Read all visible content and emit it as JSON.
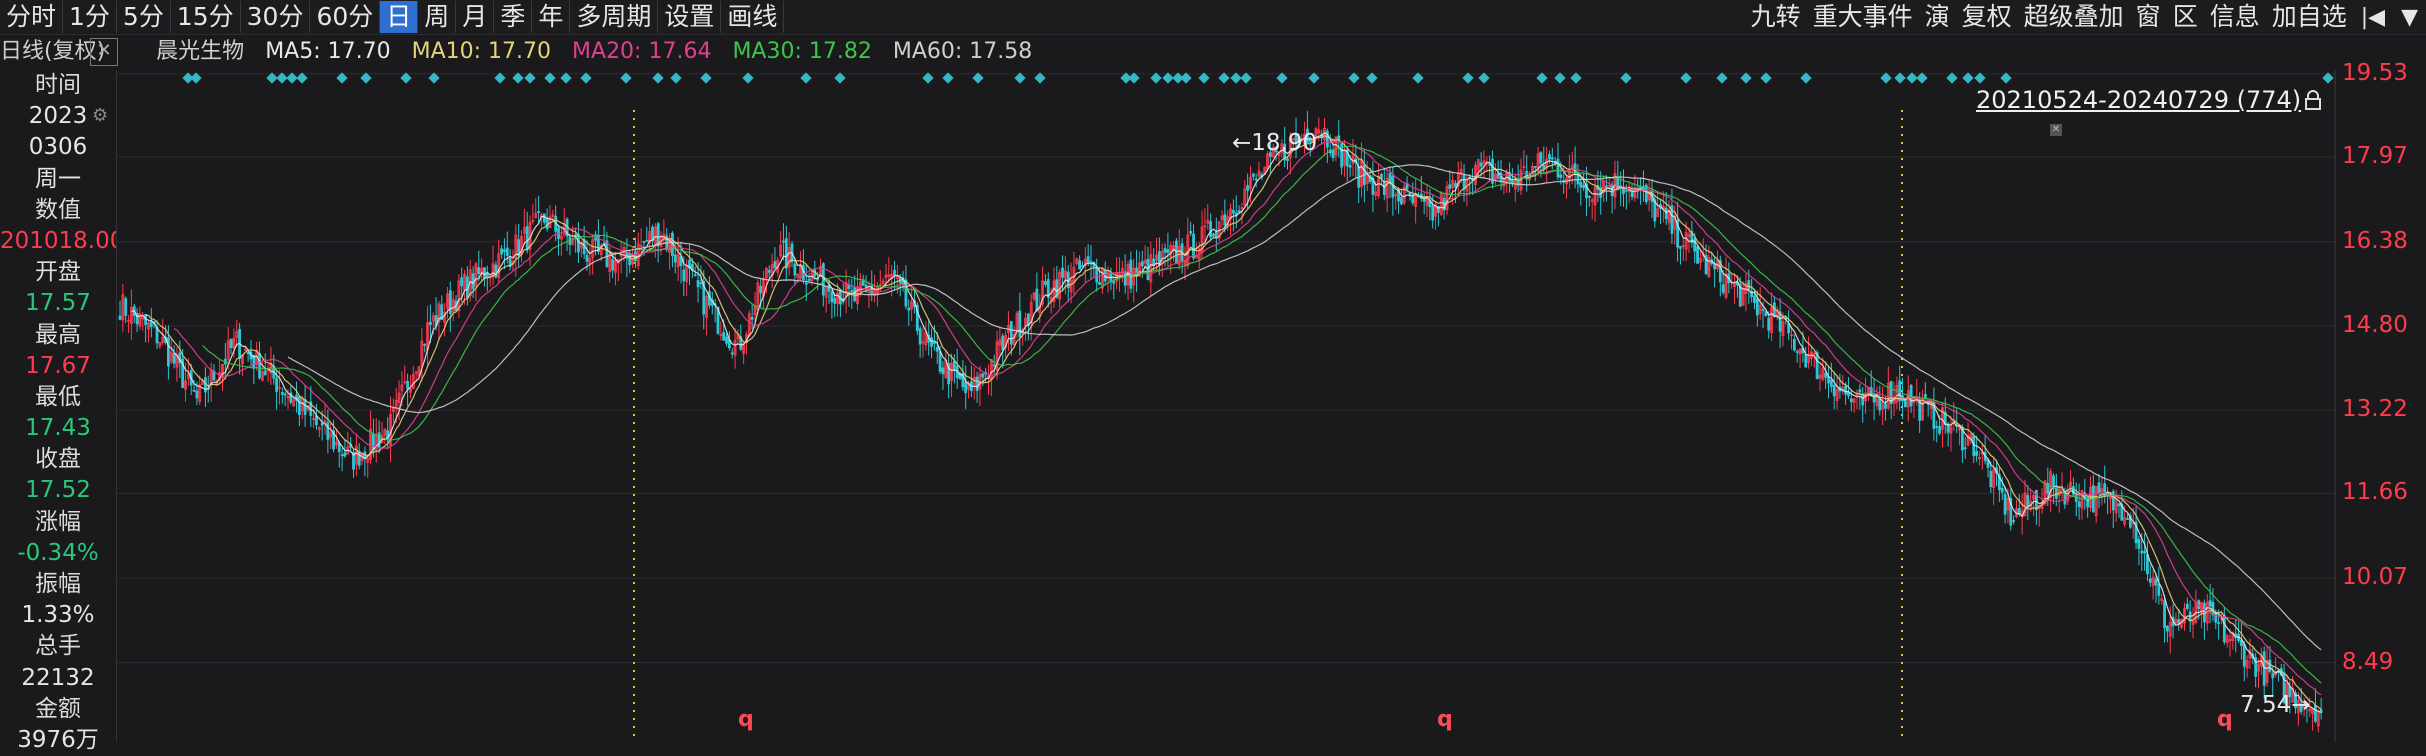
{
  "toolbar": {
    "periods": [
      "分时",
      "1分",
      "5分",
      "15分",
      "30分",
      "60分",
      "日",
      "周",
      "月",
      "季",
      "年",
      "多周期",
      "设置",
      "画线"
    ],
    "active_period": "日",
    "right_items": [
      "九转",
      "重大事件",
      "演",
      "复权",
      "超级叠加",
      "窗",
      "区",
      "信息",
      "加自选"
    ],
    "icons": [
      "prev-chart-icon",
      "dropdown-icon"
    ]
  },
  "ma_bar": {
    "period": "日线(复权)",
    "stock_name": "晨光生物",
    "ma5": "MA5: 17.70",
    "ma10": "MA10: 17.70",
    "ma20": "MA20: 17.64",
    "ma30": "MA30: 17.82",
    "ma60": "MA60: 17.58",
    "colors": {
      "ma5": "#e8e8e8",
      "ma10": "#e6d27a",
      "ma20": "#e0408f",
      "ma30": "#3ec44a",
      "ma60": "#cfcfcf"
    }
  },
  "info_panel": {
    "rows": [
      {
        "text": "时间",
        "style": "label"
      },
      {
        "text": "2023",
        "style": "white"
      },
      {
        "text": "0306",
        "style": "white"
      },
      {
        "text": "周一",
        "style": "white"
      },
      {
        "text": "数值",
        "style": "label"
      },
      {
        "text": "201018.00",
        "style": "red"
      },
      {
        "text": "开盘",
        "style": "label"
      },
      {
        "text": "17.57",
        "style": "green"
      },
      {
        "text": "最高",
        "style": "label"
      },
      {
        "text": "17.67",
        "style": "red"
      },
      {
        "text": "最低",
        "style": "label"
      },
      {
        "text": "17.43",
        "style": "green"
      },
      {
        "text": "收盘",
        "style": "label"
      },
      {
        "text": "17.52",
        "style": "green"
      },
      {
        "text": "涨幅",
        "style": "label"
      },
      {
        "text": "-0.34%",
        "style": "green"
      },
      {
        "text": "振幅",
        "style": "label"
      },
      {
        "text": "1.33%",
        "style": "white"
      },
      {
        "text": "总手",
        "style": "label"
      },
      {
        "text": "22132",
        "style": "white"
      },
      {
        "text": "金额",
        "style": "label"
      },
      {
        "text": "3976万",
        "style": "white"
      }
    ]
  },
  "range_label": "20210524-20240729 (774)",
  "high_label": "18.90",
  "low_label": "7.54",
  "q_marks": [
    "q",
    "q",
    "q"
  ],
  "chart_data": {
    "type": "candlestick",
    "title": "晨光生物 日线(复权)",
    "date_range": "20210524-20240729",
    "bar_count": 774,
    "ylim": [
      7.0,
      19.6
    ],
    "y_ticks": [
      19.53,
      17.97,
      16.38,
      14.8,
      13.22,
      11.66,
      10.07,
      8.49
    ],
    "period_high": 18.9,
    "period_low": 7.54,
    "close_trend": [
      15.2,
      14.6,
      13.4,
      14.5,
      13.8,
      13.0,
      12.3,
      12.9,
      14.8,
      15.6,
      16.1,
      16.8,
      16.2,
      16.0,
      16.6,
      15.4,
      14.4,
      16.2,
      15.7,
      15.3,
      15.7,
      14.3,
      13.5,
      14.6,
      15.5,
      15.9,
      15.7,
      16.0,
      16.4,
      17.2,
      18.0,
      18.6,
      17.7,
      17.3,
      16.9,
      17.8,
      17.5,
      17.9,
      17.4,
      17.5,
      16.8,
      16.0,
      15.4,
      14.8,
      14.0,
      13.3,
      13.6,
      13.1,
      12.6,
      11.2,
      11.8,
      11.6,
      11.4,
      9.2,
      9.4,
      8.7,
      8.0,
      7.6
    ],
    "ma_lines": [
      "MA5",
      "MA10",
      "MA20",
      "MA30",
      "MA60"
    ],
    "grid": true
  }
}
